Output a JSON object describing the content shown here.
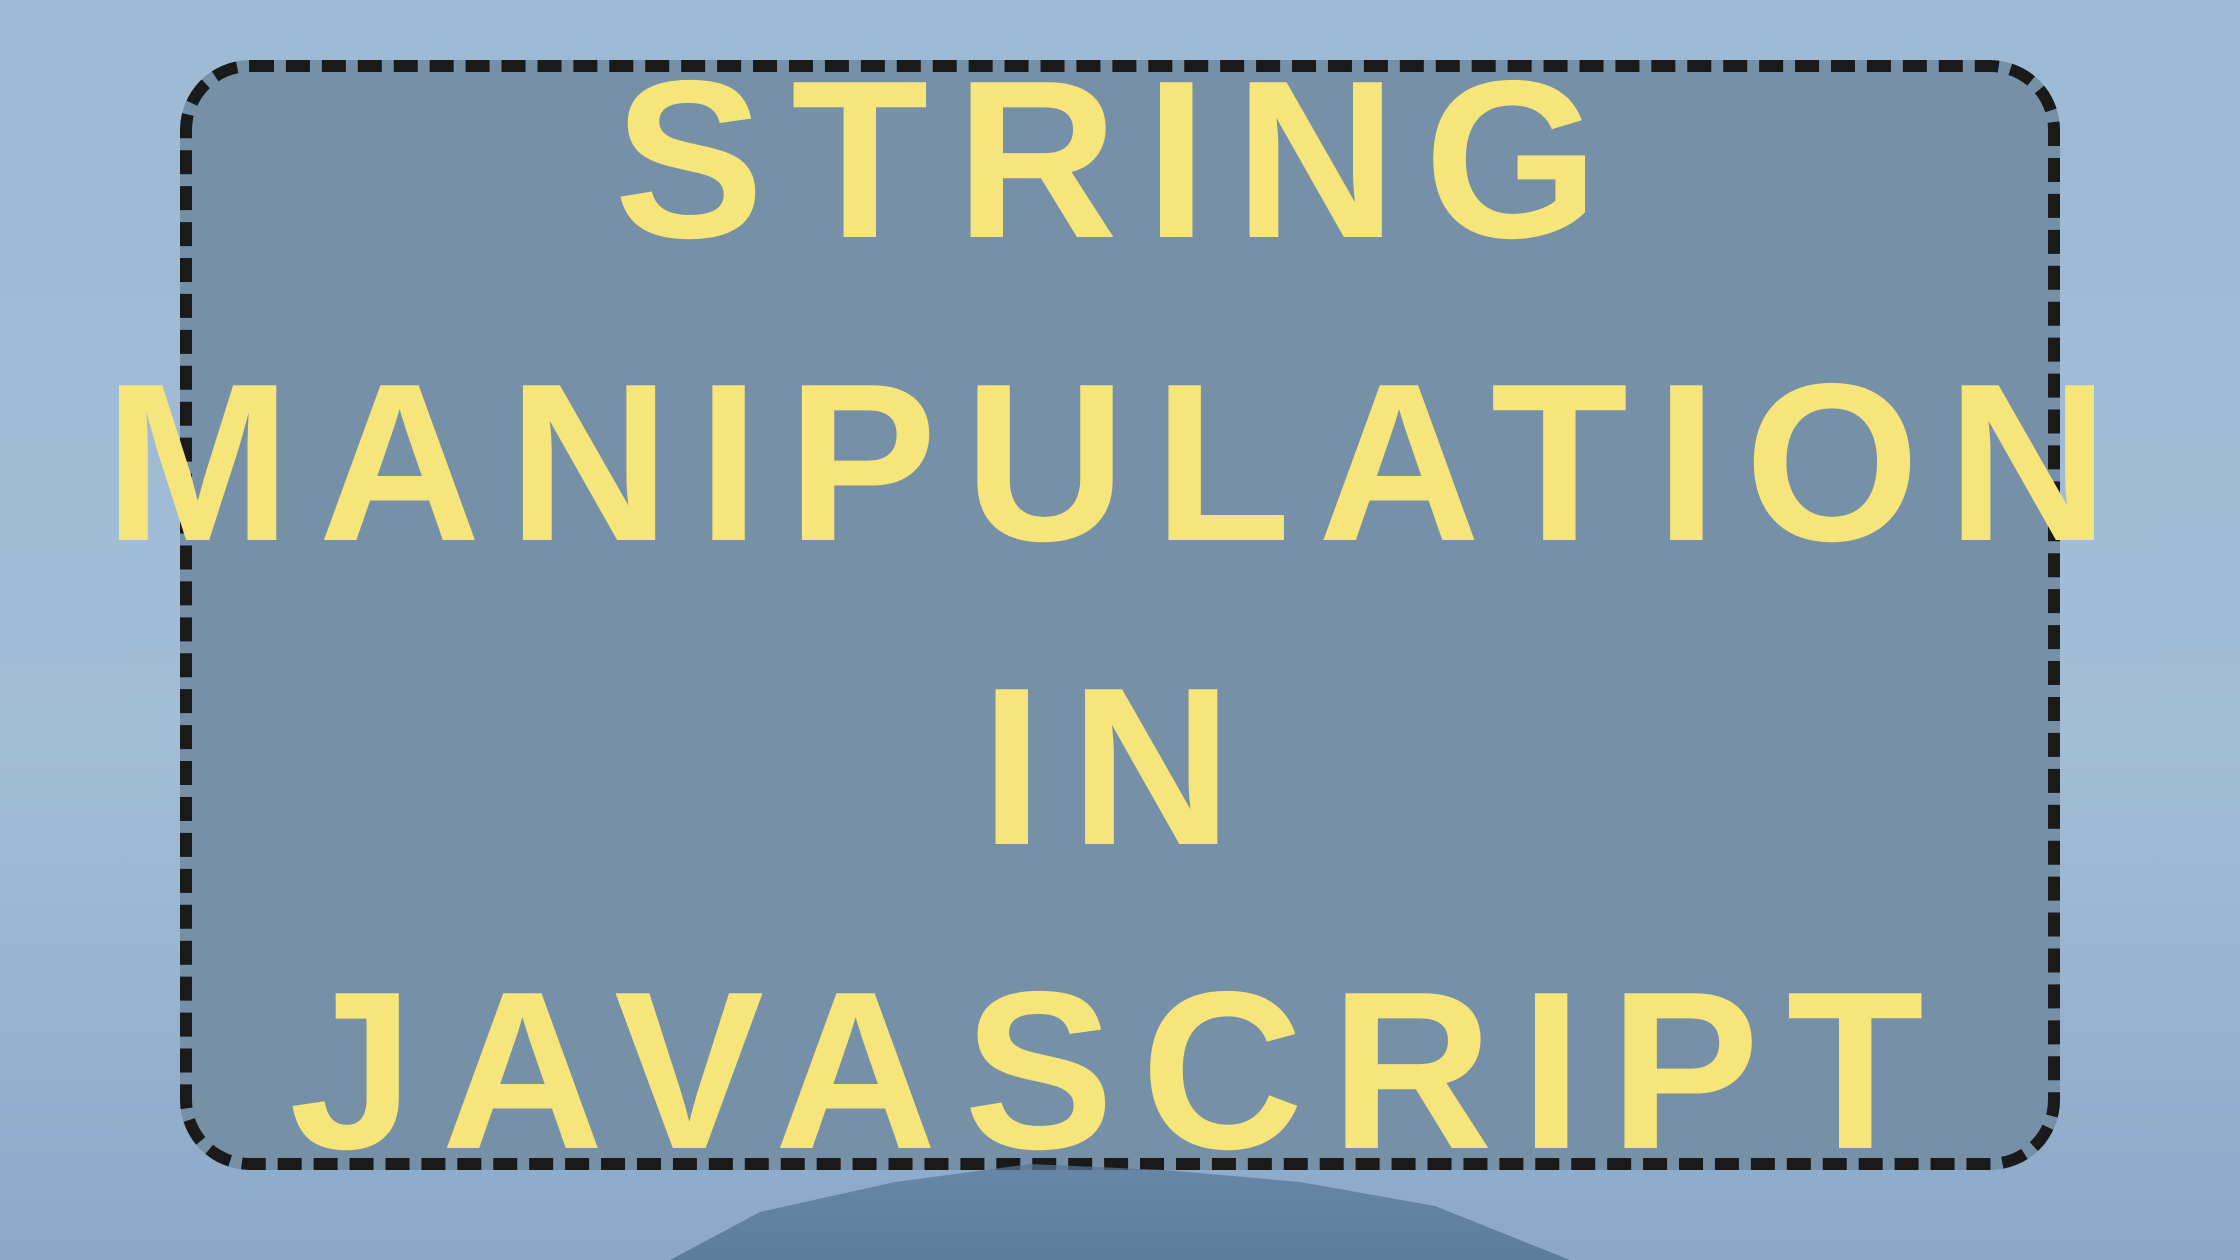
{
  "card": {
    "title": "STRING\nMANIPULATION IN\nJAVASCRIPT"
  }
}
